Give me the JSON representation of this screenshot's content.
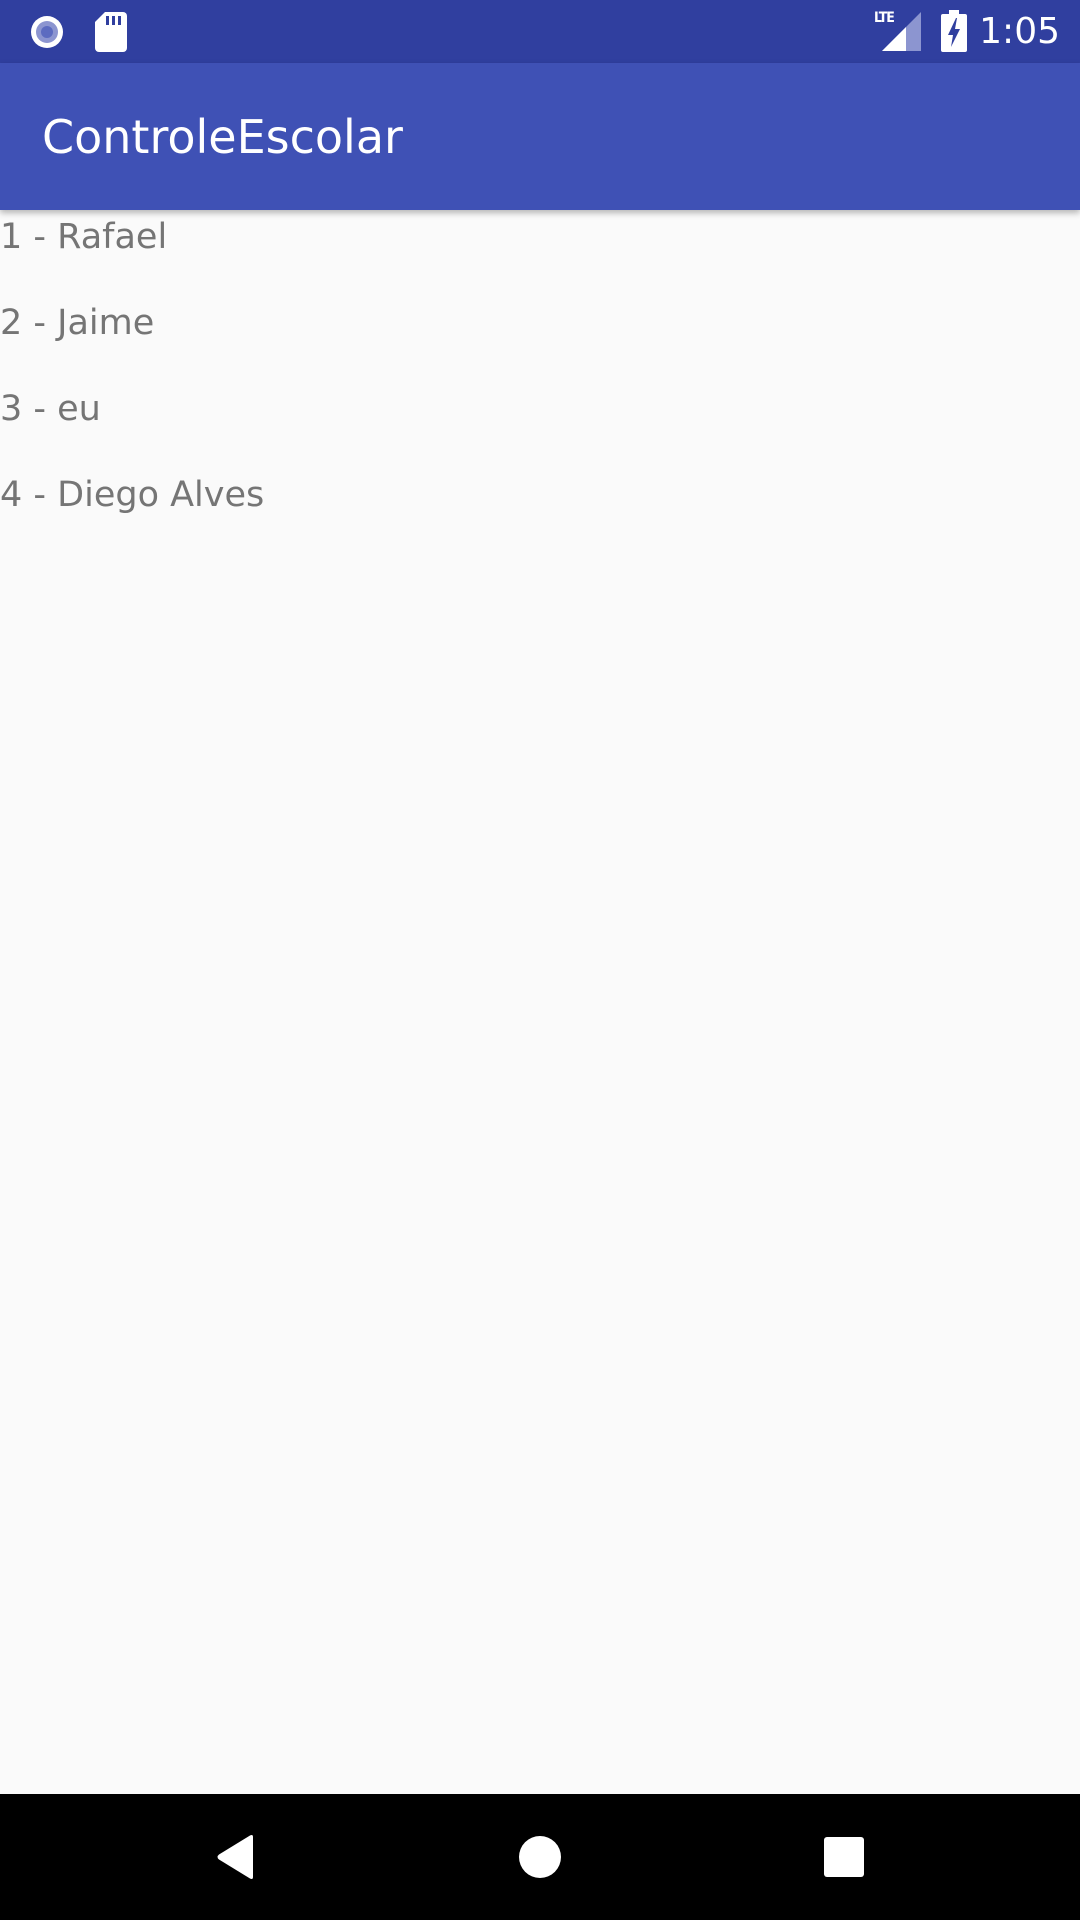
{
  "status_bar": {
    "time": "1:05",
    "network_label": "LTE",
    "left_icons": [
      "record-icon",
      "sd-card-icon"
    ],
    "right_icons": [
      "lte-signal-icon",
      "battery-charging-icon"
    ],
    "color": "#303f9f"
  },
  "app_bar": {
    "title": "ControleEscolar",
    "color": "#3f51b5"
  },
  "list": {
    "items": [
      {
        "label": "1 - Rafael"
      },
      {
        "label": "2 - Jaime"
      },
      {
        "label": "3 - eu"
      },
      {
        "label": "4 - Diego Alves"
      }
    ],
    "text_color": "#757575"
  },
  "nav_bar": {
    "buttons": [
      "back-icon",
      "home-icon",
      "recents-icon"
    ],
    "color": "#000000"
  }
}
